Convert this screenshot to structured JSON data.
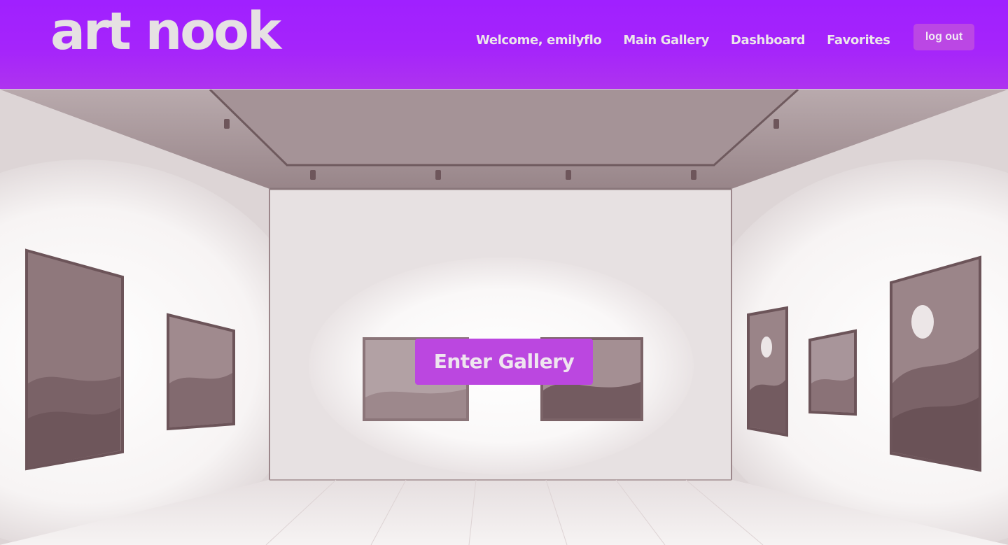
{
  "header": {
    "logo": "art nook",
    "nav": {
      "welcome": "Welcome, emilyflo",
      "main_gallery": "Main Gallery",
      "dashboard": "Dashboard",
      "favorites": "Favorites"
    },
    "logout_label": "log out"
  },
  "hero": {
    "enter_label": "Enter Gallery"
  },
  "colors": {
    "header_purple": "#a020ff",
    "button_purple": "#bb47e0",
    "wall": "#f3eff0",
    "ceiling": "#9c8a8e",
    "frame": "#7a6268"
  }
}
